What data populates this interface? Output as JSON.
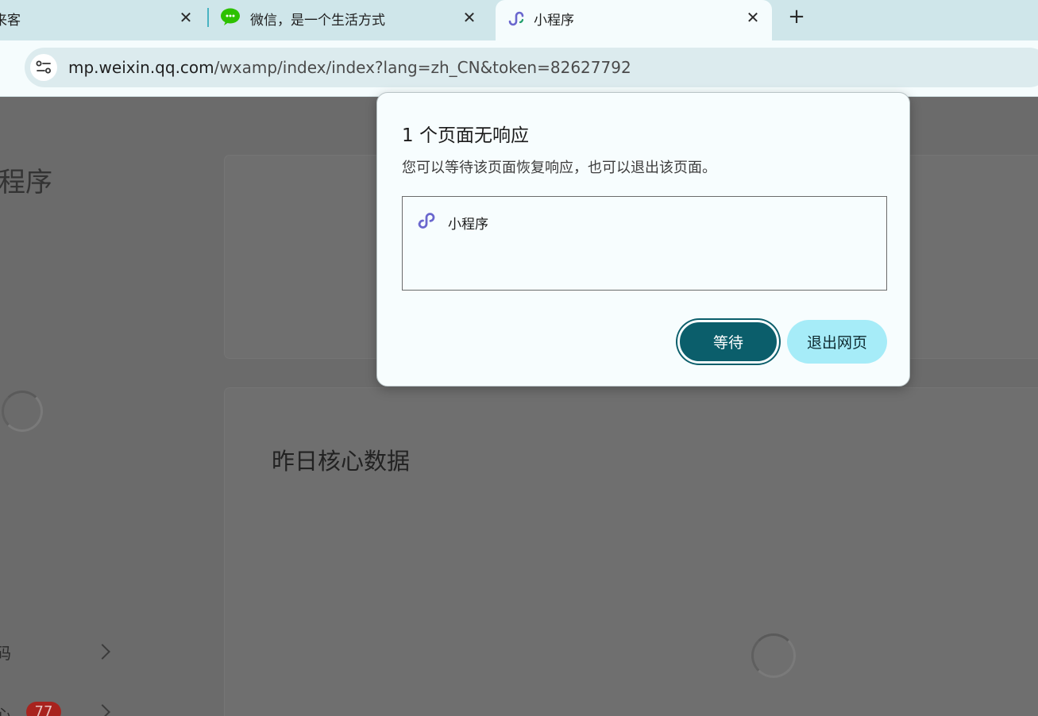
{
  "tabs": [
    {
      "title": "来客"
    },
    {
      "title": "微信，是一个生活方式"
    },
    {
      "title": "小程序",
      "active": true
    }
  ],
  "new_tab_glyph": "+",
  "close_glyph": "✕",
  "address_bar": {
    "host": "mp.weixin.qq.com",
    "path": "/wxamp/index/index?lang=zh_CN&token=82627792"
  },
  "page": {
    "title": "程序",
    "card_heading": "昨日核心数据",
    "side_items": [
      {
        "label": "码"
      },
      {
        "label": "心",
        "badge": "77"
      }
    ]
  },
  "dialog": {
    "title": "1 个页面无响应",
    "description": "您可以等待该页面恢复响应，也可以退出该页面。",
    "pages": [
      {
        "label": "小程序",
        "icon": "mini-program-icon"
      }
    ],
    "wait_label": "等待",
    "exit_label": "退出网页"
  },
  "colors": {
    "tabstrip": "#cfe6ea",
    "accent": "#0b5e6b",
    "exit_button": "#a6ecf8",
    "overlay": "#6b6b6b",
    "badge": "#a8231e",
    "wechat_green": "#2dc100",
    "mini_program_purple": "#6a67ce"
  },
  "icons": [
    "wechat-icon",
    "mini-program-icon",
    "site-info-icon",
    "close-icon",
    "plus-icon",
    "chevron-right-icon"
  ]
}
